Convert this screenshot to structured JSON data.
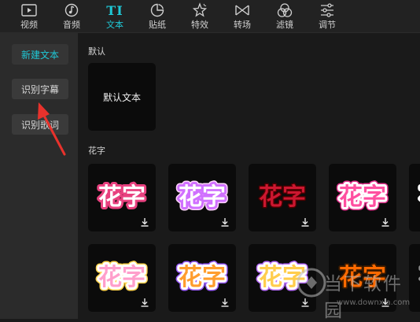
{
  "toolbar": {
    "items": [
      {
        "label": "视频",
        "icon": "video-icon"
      },
      {
        "label": "音频",
        "icon": "audio-icon"
      },
      {
        "label": "文本",
        "icon": "text-icon",
        "glyph": "TI"
      },
      {
        "label": "贴纸",
        "icon": "sticker-icon"
      },
      {
        "label": "特效",
        "icon": "effects-icon"
      },
      {
        "label": "转场",
        "icon": "transition-icon"
      },
      {
        "label": "滤镜",
        "icon": "filter-icon"
      },
      {
        "label": "调节",
        "icon": "adjust-icon"
      }
    ],
    "active_index": 2
  },
  "sidebar": {
    "buttons": [
      {
        "label": "新建文本",
        "active": true
      },
      {
        "label": "识别字幕",
        "active": false
      },
      {
        "label": "识别歌词",
        "active": false
      }
    ]
  },
  "main": {
    "default_section": {
      "title": "默认",
      "card_label": "默认文本"
    },
    "huazi_section": {
      "title": "花字",
      "card_text": "花字",
      "download_icon": "download-icon",
      "card_count": 10
    }
  },
  "watermark": {
    "text": "当下软件园",
    "url": "www.downxia.com"
  },
  "colors": {
    "accent": "#1fc8d6",
    "annotation_arrow": "#e8322c",
    "background": "#1a1a1a",
    "sidebar": "#2b2b2b",
    "card": "#0b0b0b"
  }
}
